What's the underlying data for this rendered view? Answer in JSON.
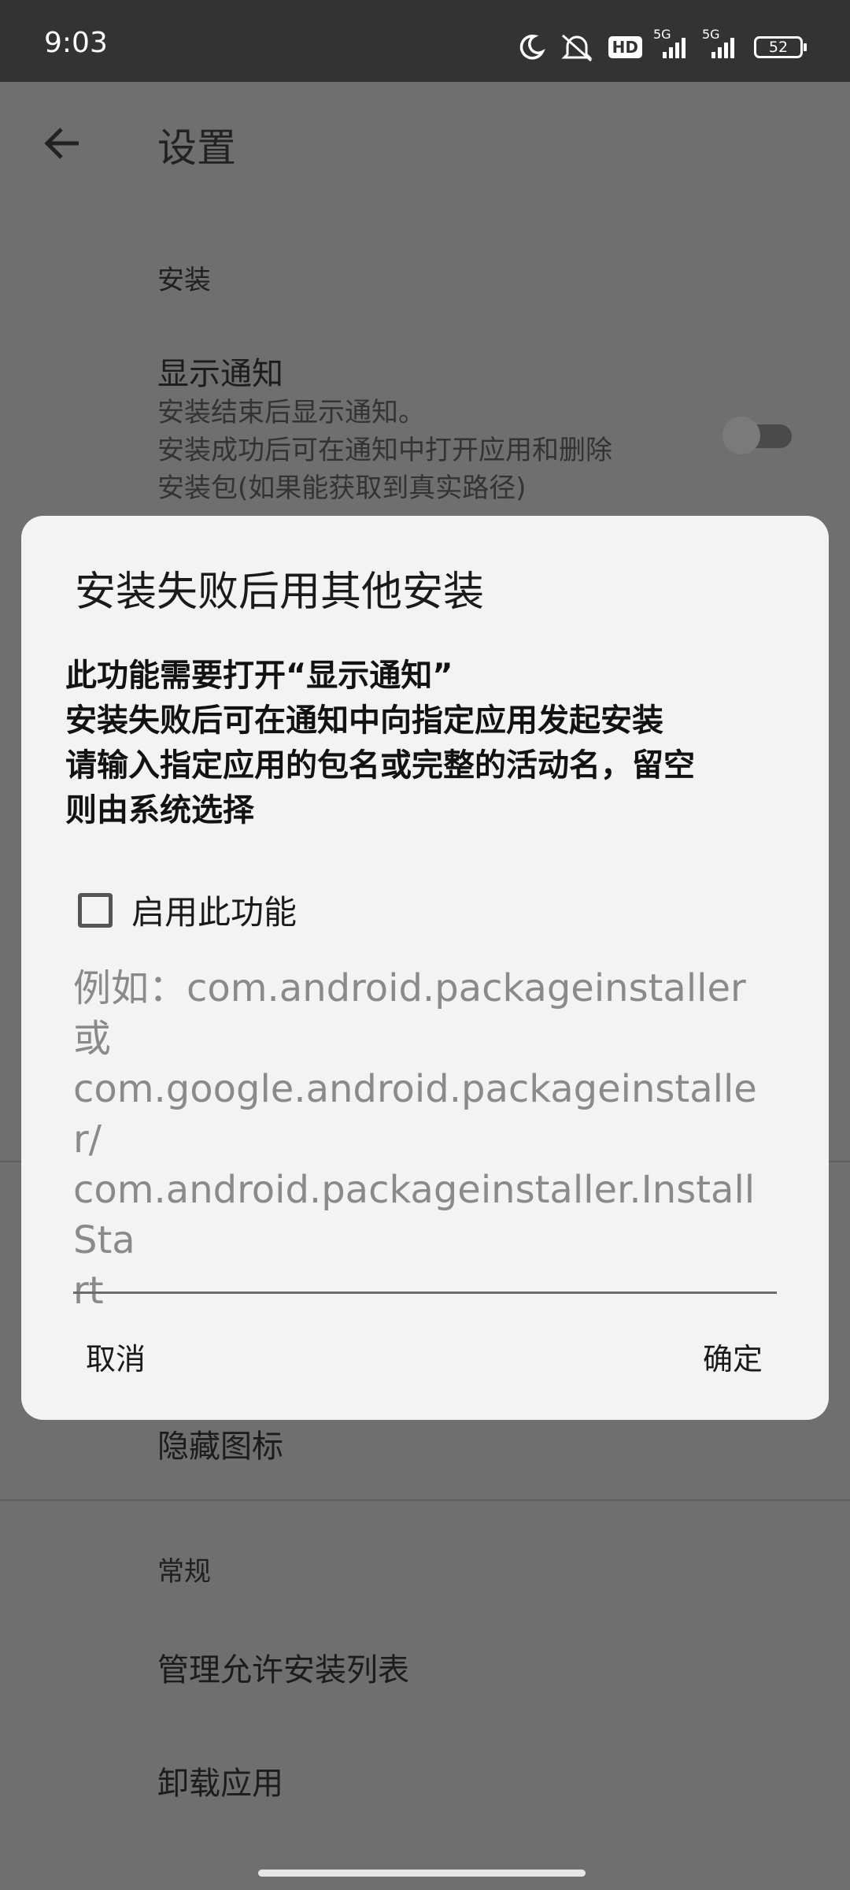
{
  "status_bar": {
    "time": "9:03",
    "network_1": "5G",
    "network_2": "5G",
    "hd_label": "HD",
    "battery": "52"
  },
  "app_bar": {
    "title": "设置"
  },
  "settings": {
    "section_install": "安装",
    "show_notification": {
      "title": "显示通知",
      "summary": "安装结束后显示通知。\n安装成功后可在通知中打开应用和删除\n安装包(如果能获取到真实路径)",
      "enabled": false
    },
    "hide_icon": "隐藏图标",
    "section_general": "常规",
    "manage_allowed": "管理允许安装列表",
    "uninstall_app": "卸载应用"
  },
  "dialog": {
    "title": "安装失败后用其他安装",
    "message": "此功能需要打开“显示通知”\n安装失败后可在通知中向指定应用发起安装\n请输入指定应用的包名或完整的活动名，留空\n则由系统选择",
    "checkbox_label": "启用此功能",
    "checkbox_checked": false,
    "input_placeholder": "例如：com.android.packageinstaller\n或\ncom.google.android.packageinstaller/\ncom.android.packageinstaller.InstallSta\nrt",
    "input_value": "",
    "cancel_label": "取消",
    "ok_label": "确定"
  }
}
